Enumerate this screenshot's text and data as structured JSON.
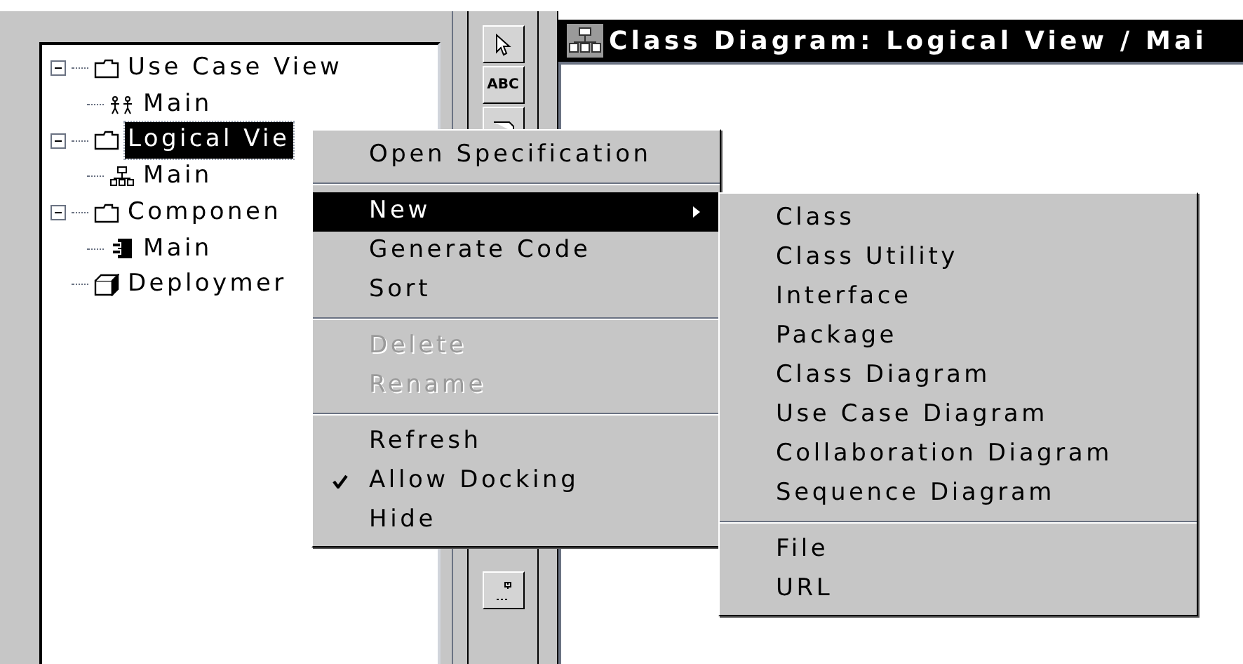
{
  "browser_tree": [
    {
      "label": "Use Case View",
      "kind": "folder",
      "expanded": true,
      "selected": false,
      "children": [
        {
          "label": "Main",
          "kind": "use-case-diagram",
          "selected": false
        }
      ]
    },
    {
      "label": "Logical Vie",
      "kind": "folder",
      "expanded": true,
      "selected": true,
      "children": [
        {
          "label": "Main",
          "kind": "class-diagram",
          "selected": false
        }
      ]
    },
    {
      "label": "Componen",
      "kind": "folder",
      "expanded": true,
      "selected": false,
      "children": [
        {
          "label": "Main",
          "kind": "component-diagram",
          "selected": false
        }
      ]
    },
    {
      "label": "Deploymer",
      "kind": "deployment",
      "selected": false
    }
  ],
  "toolbox": [
    {
      "kind": "pointer"
    },
    {
      "kind": "text",
      "label": "ABC"
    },
    {
      "kind": "note"
    },
    {
      "kind": "anchor"
    }
  ],
  "diagram_window": {
    "title": "Class Diagram: Logical View / Mai"
  },
  "context_menu": [
    {
      "kind": "item",
      "label": "Open Specification",
      "selected": false,
      "disabled": false,
      "checked": false,
      "submenu": false
    },
    {
      "kind": "separator"
    },
    {
      "kind": "item",
      "label": "New",
      "selected": true,
      "disabled": false,
      "checked": false,
      "submenu": true
    },
    {
      "kind": "item",
      "label": "Generate Code",
      "selected": false,
      "disabled": false,
      "checked": false,
      "submenu": false
    },
    {
      "kind": "item",
      "label": "Sort",
      "selected": false,
      "disabled": false,
      "checked": false,
      "submenu": false
    },
    {
      "kind": "separator"
    },
    {
      "kind": "item",
      "label": "Delete",
      "selected": false,
      "disabled": true,
      "checked": false,
      "submenu": false
    },
    {
      "kind": "item",
      "label": "Rename",
      "selected": false,
      "disabled": true,
      "checked": false,
      "submenu": false
    },
    {
      "kind": "separator"
    },
    {
      "kind": "item",
      "label": "Refresh",
      "selected": false,
      "disabled": false,
      "checked": false,
      "submenu": false
    },
    {
      "kind": "item",
      "label": "Allow Docking",
      "selected": false,
      "disabled": false,
      "checked": true,
      "submenu": false
    },
    {
      "kind": "item",
      "label": "Hide",
      "selected": false,
      "disabled": false,
      "checked": false,
      "submenu": false
    }
  ],
  "new_submenu": [
    {
      "kind": "item",
      "label": "Class"
    },
    {
      "kind": "item",
      "label": "Class Utility"
    },
    {
      "kind": "item",
      "label": "Interface"
    },
    {
      "kind": "item",
      "label": "Package"
    },
    {
      "kind": "item",
      "label": "Class Diagram"
    },
    {
      "kind": "item",
      "label": "Use Case Diagram"
    },
    {
      "kind": "item",
      "label": "Collaboration Diagram"
    },
    {
      "kind": "item",
      "label": "Sequence Diagram"
    },
    {
      "kind": "separator"
    },
    {
      "kind": "item",
      "label": "File"
    },
    {
      "kind": "item",
      "label": "URL"
    }
  ]
}
